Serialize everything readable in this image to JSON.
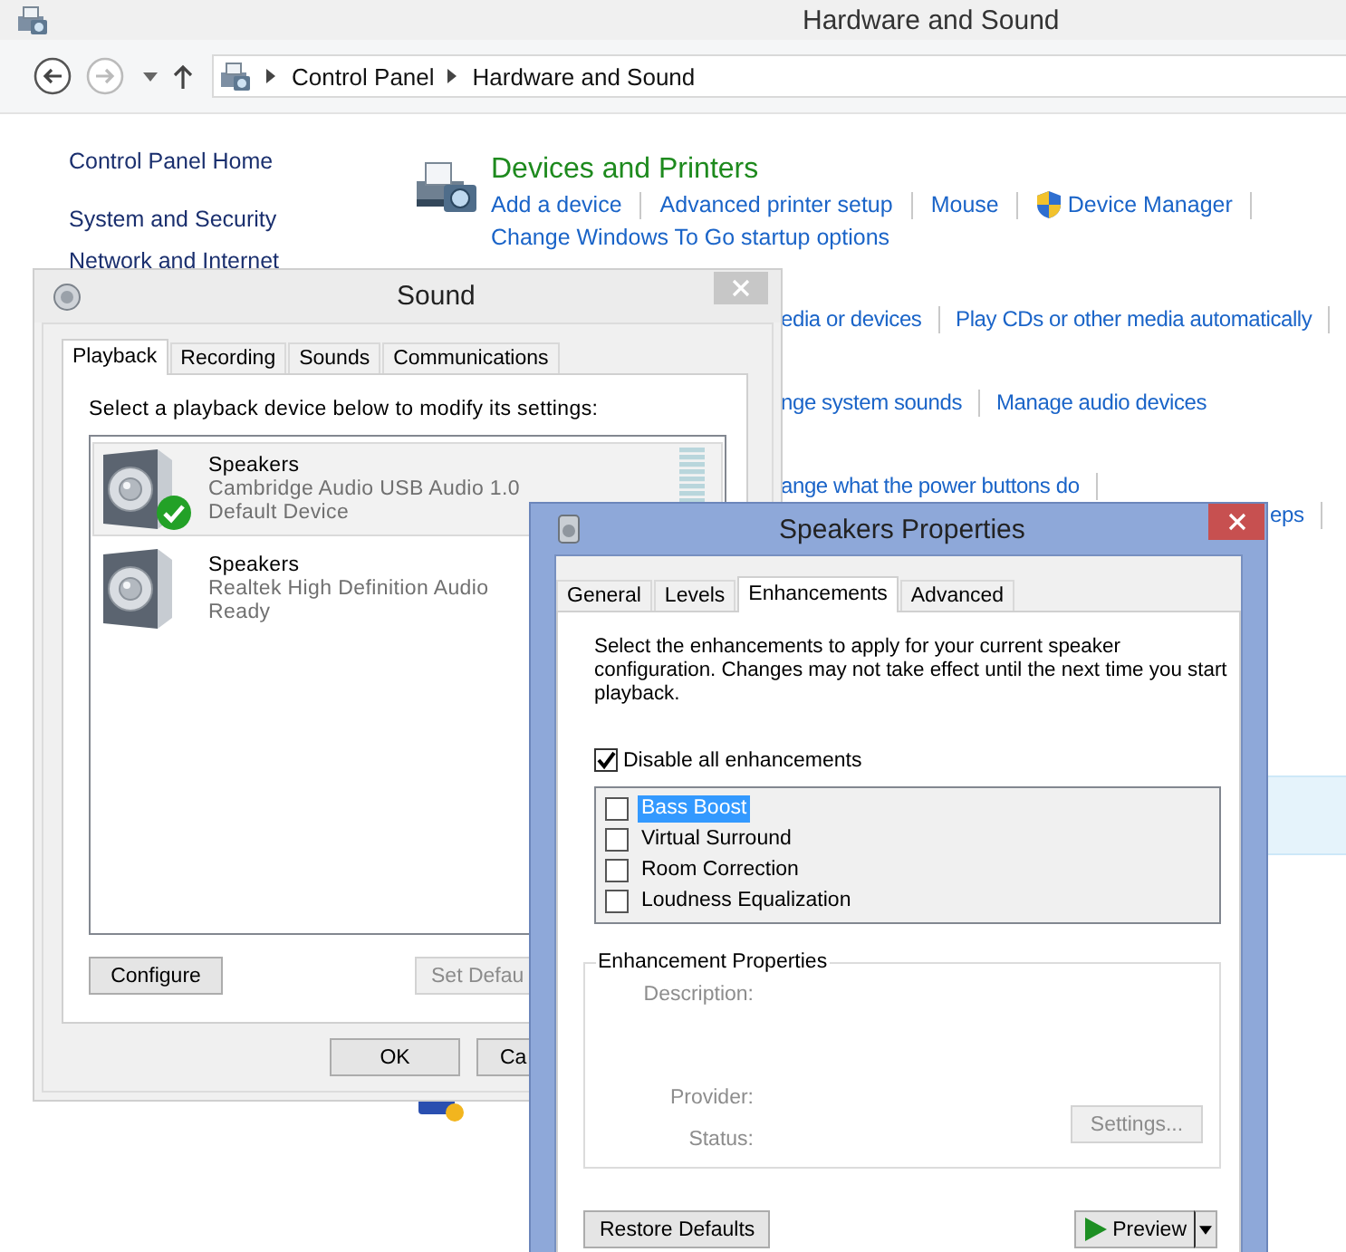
{
  "control_panel": {
    "title": "Hardware and Sound",
    "breadcrumb": [
      "Control Panel",
      "Hardware and Sound"
    ],
    "nav": [
      "Control Panel Home",
      "System and Security",
      "Network and Internet"
    ],
    "section": {
      "title": "Devices and Printers",
      "links": [
        {
          "text": "Add a device",
          "kind": "plain"
        },
        {
          "text": "Advanced printer setup",
          "kind": "plain"
        },
        {
          "text": "Mouse",
          "kind": "plain"
        },
        {
          "text": "Device Manager",
          "kind": "shield"
        }
      ],
      "second_line": "Change Windows To Go startup options"
    },
    "partial_rows": [
      [
        "edia or devices",
        "Play CDs or other media automatically"
      ],
      [
        "nge system sounds",
        "Manage audio devices"
      ],
      [
        "ange what the power buttons do"
      ],
      [
        "eps"
      ]
    ]
  },
  "sound_dialog": {
    "title": "Sound",
    "tabs": [
      {
        "label": "Playback",
        "selected": true
      },
      {
        "label": "Recording",
        "selected": false
      },
      {
        "label": "Sounds",
        "selected": false
      },
      {
        "label": "Communications",
        "selected": false
      }
    ],
    "instruction": "Select a playback device below to modify its settings:",
    "devices": [
      {
        "name": "Speakers",
        "description": "Cambridge Audio USB Audio 1.0",
        "status": "Default Device",
        "default": true,
        "selected": true
      },
      {
        "name": "Speakers",
        "description": "Realtek High Definition Audio",
        "status": "Ready",
        "default": false,
        "selected": false
      }
    ],
    "buttons": [
      {
        "label": "Configure",
        "disabled": false
      },
      {
        "label": "Set Defau",
        "disabled": true
      }
    ],
    "footer_buttons": [
      "OK",
      "Ca"
    ]
  },
  "speakers_dialog": {
    "title": "Speakers Properties",
    "tabs": [
      {
        "label": "General",
        "selected": false
      },
      {
        "label": "Levels",
        "selected": false
      },
      {
        "label": "Enhancements",
        "selected": true
      },
      {
        "label": "Advanced",
        "selected": false
      }
    ],
    "intro": "Select the enhancements to apply for your current speaker configuration. Changes may not take effect until the next time you start playback.",
    "disable_all": {
      "label": "Disable all enhancements",
      "checked": true
    },
    "enhancements": [
      {
        "label": "Bass Boost",
        "checked": false,
        "selected": true
      },
      {
        "label": "Virtual Surround",
        "checked": false,
        "selected": false
      },
      {
        "label": "Room Correction",
        "checked": false,
        "selected": false
      },
      {
        "label": "Loudness Equalization",
        "checked": false,
        "selected": false
      }
    ],
    "properties": {
      "title": "Enhancement Properties",
      "fields": [
        "Description:",
        "Provider:",
        "Status:"
      ],
      "settings_button": {
        "label": "Settings...",
        "disabled": true
      }
    },
    "restore_button": "Restore Defaults",
    "preview_button": "Preview"
  }
}
